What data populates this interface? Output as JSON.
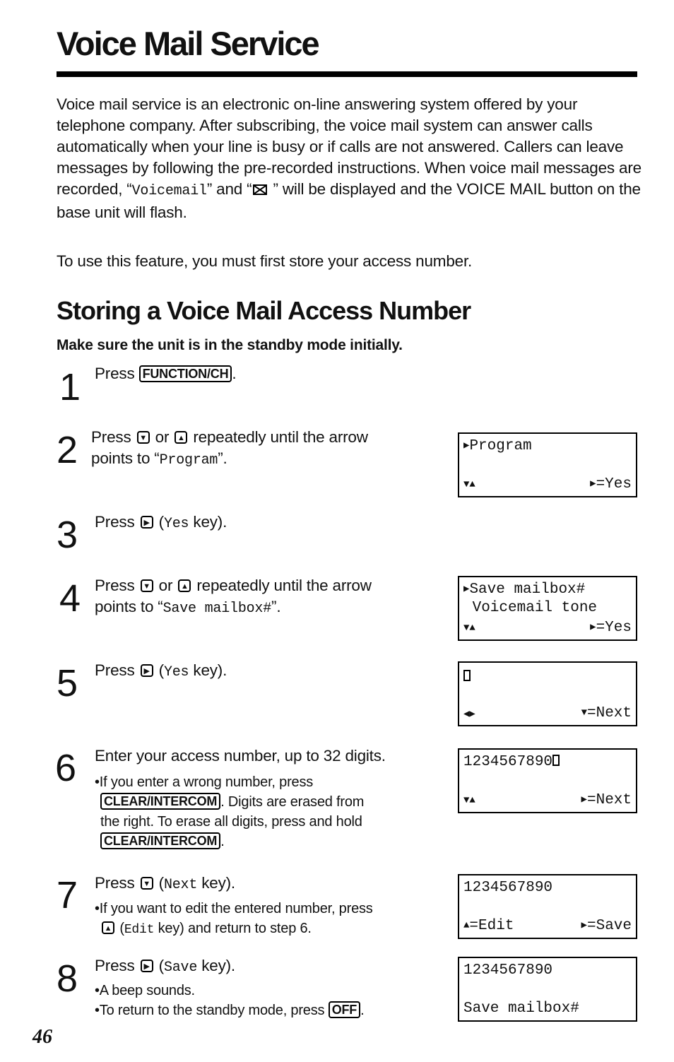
{
  "header": {
    "title": "Voice Mail Service"
  },
  "intro": {
    "p1_part1": "Voice mail service is an electronic on-line answering system offered by your telephone company. After subscribing, the voice mail system can answer calls automatically when your line is busy or if calls are not answered. Callers can leave messages by following the pre-recorded instructions. When voice mail messages are recorded, “",
    "p1_mono": "Voicemail",
    "p1_part2": "” and “",
    "p1_icon": "envelope-icon",
    "p1_part3": " ” will be displayed and the VOICE MAIL button on the base unit will flash.",
    "p2": "To use this feature, you must first store your access number."
  },
  "section": {
    "title": "Storing a Voice Mail Access Number",
    "subtitle": "Make sure the unit is in the standby mode initially."
  },
  "steps": [
    {
      "num": "1",
      "press": "Press ",
      "key": "FUNCTION/CH",
      "after": "."
    },
    {
      "num": "2",
      "press": "Press ",
      "or": " or ",
      "rest1": " repeatedly until the arrow",
      "rest2a": "points to “",
      "mono": "Program",
      "rest2b": "”."
    },
    {
      "num": "3",
      "press": "Press ",
      "open": " (",
      "mono": "Yes",
      "close": " key)."
    },
    {
      "num": "4",
      "press": "Press ",
      "or": " or ",
      "rest1": " repeatedly until the arrow",
      "rest2a": "points to “",
      "mono": "Save mailbox#",
      "rest2b": "”."
    },
    {
      "num": "5",
      "press": "Press ",
      "open": " (",
      "mono": "Yes",
      "close": " key)."
    },
    {
      "num": "6",
      "text": "Enter your access number, up to 32 digits.",
      "b1": "•If you enter a wrong number, press",
      "key": "CLEAR/INTERCOM",
      "b2": ". Digits are erased from",
      "b3": "the right. To erase all digits, press and hold",
      "b4": "."
    },
    {
      "num": "7",
      "press": "Press ",
      "open": " (",
      "mono": "Next",
      "close": " key).",
      "b1": "•If you want to edit the entered number, press",
      "b2open": " (",
      "b2mono": "Edit",
      "b2close": " key) and return to step 6."
    },
    {
      "num": "8",
      "press": "Press ",
      "open": " (",
      "mono": "Save",
      "close": " key).",
      "b1": "•A beep sounds.",
      "b2": "•To return to the standby mode, press ",
      "key": "OFF",
      "b2end": "."
    }
  ],
  "arrows": {
    "down": "▼",
    "up": "▲",
    "right": "▶",
    "left": "◀"
  },
  "displays": [
    {
      "line1": "Program",
      "line1_arrow": "▶",
      "line2": "",
      "bl": "▼▲",
      "br_arrow": "▶",
      "br": "=Yes"
    },
    {
      "line1": "Save mailbox#",
      "line1_arrow": "▶",
      "line2": " Voicemail tone",
      "bl": "▼▲",
      "br_arrow": "▶",
      "br": "=Yes"
    },
    {
      "line1": "",
      "line2": "",
      "bl": "◀▶",
      "br_arrow": "▼",
      "br": "=Next"
    },
    {
      "line1": "1234567890",
      "line2": "",
      "bl": "▼▲",
      "br_arrow": "▶",
      "br": "=Next"
    },
    {
      "line1": "1234567890",
      "line2": "",
      "bl_arrow": "▲",
      "bl": "=Edit",
      "br_arrow": "▶",
      "br": "=Save"
    },
    {
      "line1": "1234567890",
      "line2": "",
      "bl": "Save mailbox#",
      "br": ""
    }
  ],
  "footer": {
    "page_number": "46"
  }
}
